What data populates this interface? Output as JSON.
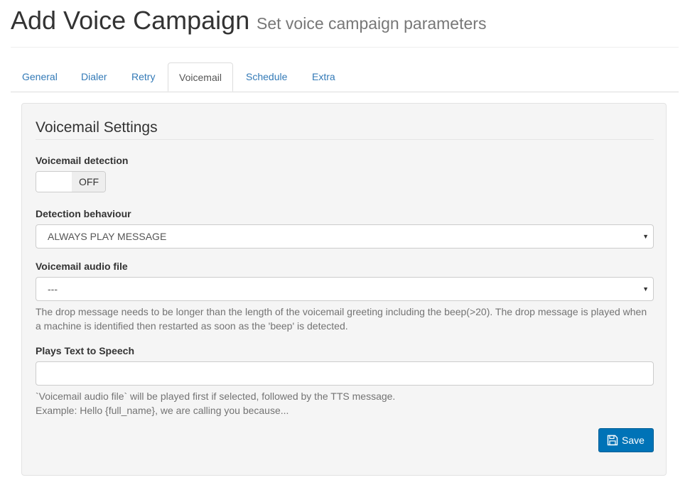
{
  "header": {
    "title": "Add Voice Campaign",
    "subtitle": "Set voice campaign parameters"
  },
  "tabs": [
    {
      "label": "General"
    },
    {
      "label": "Dialer"
    },
    {
      "label": "Retry"
    },
    {
      "label": "Voicemail",
      "active": true
    },
    {
      "label": "Schedule"
    },
    {
      "label": "Extra"
    }
  ],
  "panel": {
    "legend": "Voicemail Settings",
    "voicemail_detection": {
      "label": "Voicemail detection",
      "state": "OFF"
    },
    "detection_behaviour": {
      "label": "Detection behaviour",
      "selected": "ALWAYS PLAY MESSAGE"
    },
    "audio_file": {
      "label": "Voicemail audio file",
      "selected": "---",
      "help": "The drop message needs to be longer than the length of the voicemail greeting including the beep(>20). The drop message is played when a machine is identified then restarted as soon as the 'beep' is detected."
    },
    "tts": {
      "label": "Plays Text to Speech",
      "value": "",
      "help_line1": "`Voicemail audio file` will be played first if selected, followed by the TTS message.",
      "help_line2": "Example: Hello {full_name}, we are calling you because..."
    },
    "save_label": "Save",
    "save_icon": "floppy-disk-icon"
  },
  "colors": {
    "link": "#337ab7",
    "primary": "#0073b7"
  }
}
